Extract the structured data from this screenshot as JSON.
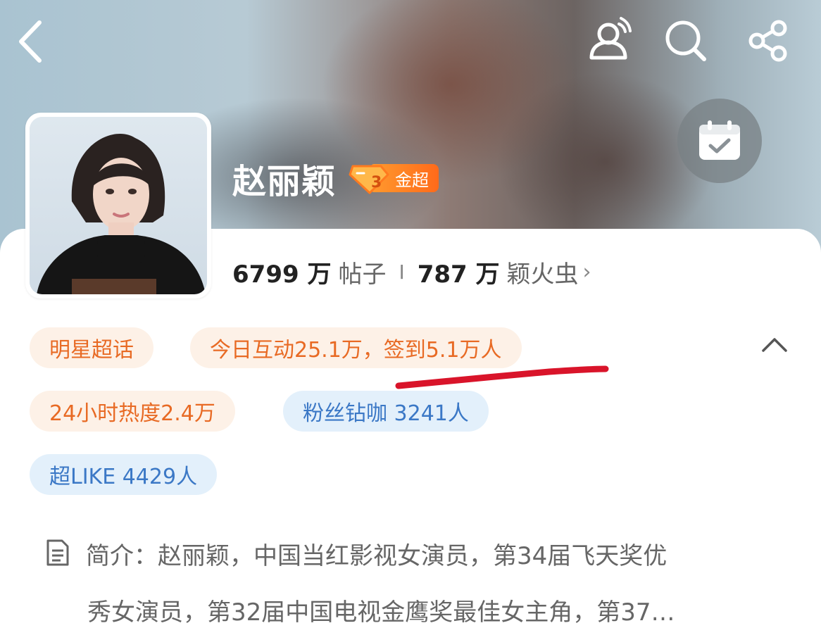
{
  "topbar": {
    "back_icon": "chevron-left-icon",
    "customer_icon": "customer-service-icon",
    "search_icon": "search-icon",
    "share_icon": "share-icon"
  },
  "profile": {
    "name": "赵丽颖",
    "level_number": "3",
    "level_label": "金超",
    "checkin_icon": "calendar-check-icon"
  },
  "stats": {
    "posts_count": "6799 万",
    "posts_label": "帖子",
    "separator": "I",
    "fans_count": "787 万",
    "fans_label": "颖火虫",
    "more": "›"
  },
  "tags": {
    "category": "明星超话",
    "today": "今日互动25.1万，签到5.1万人",
    "heat": "24小时热度2.4万",
    "fans_vip": "粉丝钻咖 3241人",
    "super_like": "超LIKE 4429人"
  },
  "intro": {
    "line1": "简介：赵丽颖，中国当红影视女演员，第34届飞天奖优",
    "line2": "秀女演员，第32届中国电视金鹰奖最佳女主角，第37…"
  },
  "colors": {
    "accent_orange": "#e86a24",
    "accent_blue": "#3b78c6",
    "underline_red": "#d9142a",
    "badge_orange": "#ff7a1f"
  }
}
